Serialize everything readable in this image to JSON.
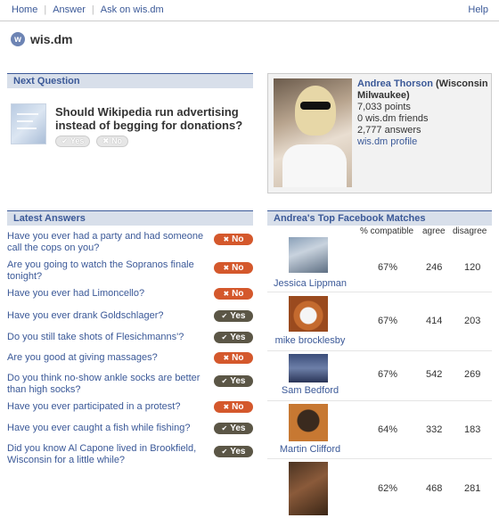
{
  "nav": {
    "items": [
      "Home",
      "Answer",
      "Ask on wis.dm"
    ],
    "help": "Help"
  },
  "brand": {
    "name": "wis.dm",
    "logo_letter": "w"
  },
  "next_question": {
    "header": "Next Question",
    "text": "Should Wikipedia run advertising instead of begging for donations?",
    "yes_label": "Yes",
    "no_label": "No"
  },
  "profile": {
    "name": "Andrea Thorson",
    "location": "(Wisconsin Milwaukee)",
    "points": "7,033 points",
    "friends": "0 wis.dm friends",
    "answers": "2,777 answers",
    "link": "wis.dm profile"
  },
  "latest_answers": {
    "header": "Latest Answers",
    "items": [
      {
        "question": "Have you ever had a party and had someone call the cops on you?",
        "answer": "No"
      },
      {
        "question": "Are you going to watch the Sopranos finale tonight?",
        "answer": "No"
      },
      {
        "question": "Have you ever had Limoncello?",
        "answer": "No"
      },
      {
        "question": "Have you ever drank Goldschlager?",
        "answer": "Yes"
      },
      {
        "question": "Do you still take shots of Flesichmanns'?",
        "answer": "Yes"
      },
      {
        "question": "Are you good at giving massages?",
        "answer": "No"
      },
      {
        "question": "Do you think no-show ankle socks are better than high socks?",
        "answer": "Yes"
      },
      {
        "question": "Have you ever participated in a protest?",
        "answer": "No"
      },
      {
        "question": "Have you ever caught a fish while fishing?",
        "answer": "Yes"
      },
      {
        "question": "Did you know Al Capone lived in Brookfield, Wisconsin for a little while?",
        "answer": "Yes"
      }
    ]
  },
  "matches": {
    "header": "Andrea's Top Facebook Matches",
    "col_compatible": "% compatible",
    "col_agree": "agree",
    "col_disagree": "disagree",
    "rows": [
      {
        "name": "Jessica Lippman",
        "compatible": "67%",
        "agree": "246",
        "disagree": "120"
      },
      {
        "name": "mike brocklesby",
        "compatible": "67%",
        "agree": "414",
        "disagree": "203"
      },
      {
        "name": "Sam Bedford",
        "compatible": "67%",
        "agree": "542",
        "disagree": "269"
      },
      {
        "name": "Martin Clifford",
        "compatible": "64%",
        "agree": "332",
        "disagree": "183"
      },
      {
        "name": "",
        "compatible": "62%",
        "agree": "468",
        "disagree": "281"
      }
    ]
  }
}
